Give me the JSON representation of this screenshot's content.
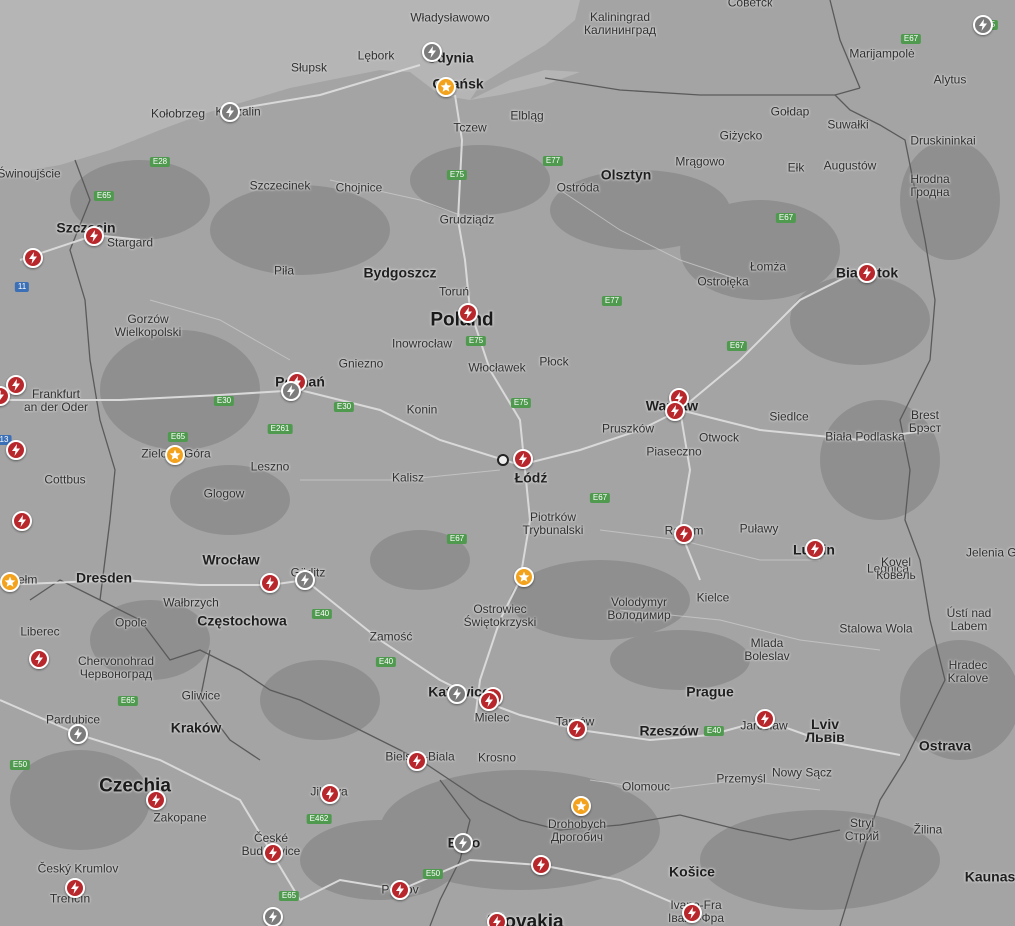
{
  "map": {
    "countries": [
      "Poland",
      "Czechia",
      "Slovakia"
    ],
    "cities": [
      {
        "name": "Władysławowo",
        "cls": "town"
      },
      {
        "name": "Gdynia",
        "cls": "big"
      },
      {
        "name": "Gdańsk",
        "cls": "big"
      },
      {
        "name": "Kaliningrad\nКалининград",
        "cls": "town"
      },
      {
        "name": "Советск",
        "cls": "town"
      },
      {
        "name": "Lębork",
        "cls": "town"
      },
      {
        "name": "Słupsk",
        "cls": "town"
      },
      {
        "name": "Kołobrzeg",
        "cls": "town"
      },
      {
        "name": "Koszalin",
        "cls": "town"
      },
      {
        "name": "Tczew",
        "cls": "town"
      },
      {
        "name": "Elbląg",
        "cls": "town"
      },
      {
        "name": "Marijampolė",
        "cls": "town"
      },
      {
        "name": "Alytus",
        "cls": "town"
      },
      {
        "name": "Gołdap",
        "cls": "town"
      },
      {
        "name": "Suwałki",
        "cls": "town"
      },
      {
        "name": "Giżycko",
        "cls": "town"
      },
      {
        "name": "Druskininkai",
        "cls": "town"
      },
      {
        "name": "Świnoujście",
        "cls": "town"
      },
      {
        "name": "Szczecinek",
        "cls": "town"
      },
      {
        "name": "Chojnice",
        "cls": "town"
      },
      {
        "name": "Ostróda",
        "cls": "town"
      },
      {
        "name": "Olsztyn",
        "cls": "big"
      },
      {
        "name": "Mrągowo",
        "cls": "town"
      },
      {
        "name": "Ełk",
        "cls": "town"
      },
      {
        "name": "Augustów",
        "cls": "town"
      },
      {
        "name": "Hrodna\nГродна",
        "cls": "town"
      },
      {
        "name": "Szczecin",
        "cls": "big"
      },
      {
        "name": "Stargard",
        "cls": "town"
      },
      {
        "name": "Grudziądz",
        "cls": "town"
      },
      {
        "name": "Piła",
        "cls": "town"
      },
      {
        "name": "Bydgoszcz",
        "cls": "big"
      },
      {
        "name": "Toruń",
        "cls": "town"
      },
      {
        "name": "Łomża",
        "cls": "town"
      },
      {
        "name": "Ostrołęka",
        "cls": "town"
      },
      {
        "name": "Białystok",
        "cls": "big"
      },
      {
        "name": "Gorzów\nWielkopolski",
        "cls": "town"
      },
      {
        "name": "Inowrocław",
        "cls": "town"
      },
      {
        "name": "Gniezno",
        "cls": "town"
      },
      {
        "name": "Włocławek",
        "cls": "town"
      },
      {
        "name": "Płock",
        "cls": "town"
      },
      {
        "name": "Poznań",
        "cls": "big"
      },
      {
        "name": "Frankfurt\nan der Oder",
        "cls": "town"
      },
      {
        "name": "Konin",
        "cls": "town"
      },
      {
        "name": "Warsaw",
        "cls": "big"
      },
      {
        "name": "Siedlce",
        "cls": "town"
      },
      {
        "name": "Brest\nБрэст",
        "cls": "town"
      },
      {
        "name": "Biała Podlaska",
        "cls": "town"
      },
      {
        "name": "Pruszków",
        "cls": "town"
      },
      {
        "name": "Otwock",
        "cls": "town"
      },
      {
        "name": "Piaseczno",
        "cls": "town"
      },
      {
        "name": "Zielona Góra",
        "cls": "town"
      },
      {
        "name": "Leszno",
        "cls": "town"
      },
      {
        "name": "Kalisz",
        "cls": "town"
      },
      {
        "name": "Łódź",
        "cls": "big"
      },
      {
        "name": "Cottbus",
        "cls": "town"
      },
      {
        "name": "Glogow",
        "cls": "town"
      },
      {
        "name": "Piotrków\nTrybunalski",
        "cls": "town"
      },
      {
        "name": "Radom",
        "cls": "town"
      },
      {
        "name": "Puławy",
        "cls": "town"
      },
      {
        "name": "Lublin",
        "cls": "big"
      },
      {
        "name": "Legnica",
        "cls": "town"
      },
      {
        "name": "Wrocław",
        "cls": "big"
      },
      {
        "name": "Görlitz",
        "cls": "town"
      },
      {
        "name": "Dresden",
        "cls": "big"
      },
      {
        "name": "Chełm",
        "cls": "town"
      },
      {
        "name": "Kovel\nКовель",
        "cls": "town"
      },
      {
        "name": "Jelenia Góra",
        "cls": "town"
      },
      {
        "name": "Wałbrzych",
        "cls": "town"
      },
      {
        "name": "Częstochowa",
        "cls": "big"
      },
      {
        "name": "Ostrowiec\nŚwiętokrzyski",
        "cls": "town"
      },
      {
        "name": "Kielce",
        "cls": "town"
      },
      {
        "name": "Volodymyr\nВолодимир",
        "cls": "town"
      },
      {
        "name": "Ústí nad\nLabem",
        "cls": "town"
      },
      {
        "name": "Liberec",
        "cls": "town"
      },
      {
        "name": "Opole",
        "cls": "town"
      },
      {
        "name": "Zamość",
        "cls": "town"
      },
      {
        "name": "Stalowa Wola",
        "cls": "town"
      },
      {
        "name": "Mlada\nBoleslav",
        "cls": "town"
      },
      {
        "name": "Chervonohrad\nЧервоноград",
        "cls": "town"
      },
      {
        "name": "Hradec\nKralove",
        "cls": "town"
      },
      {
        "name": "Gliwice",
        "cls": "town"
      },
      {
        "name": "Katowice",
        "cls": "big"
      },
      {
        "name": "Mielec",
        "cls": "town"
      },
      {
        "name": "Prague",
        "cls": "big"
      },
      {
        "name": "Pardubice",
        "cls": "town"
      },
      {
        "name": "Kraków",
        "cls": "big"
      },
      {
        "name": "Tarnów",
        "cls": "town"
      },
      {
        "name": "Rzeszów",
        "cls": "big"
      },
      {
        "name": "Jarosław",
        "cls": "town"
      },
      {
        "name": "Lviv\nЛьвів",
        "cls": "big"
      },
      {
        "name": "Ostrava",
        "cls": "big"
      },
      {
        "name": "Bielsko-Biala",
        "cls": "town"
      },
      {
        "name": "Krosno",
        "cls": "town"
      },
      {
        "name": "Przemyśl",
        "cls": "town"
      },
      {
        "name": "Nowy Sącz",
        "cls": "town"
      },
      {
        "name": "Olomouc",
        "cls": "town"
      },
      {
        "name": "Jihlava",
        "cls": "town"
      },
      {
        "name": "Zakopane",
        "cls": "town"
      },
      {
        "name": "Drohobych\nДрогобич",
        "cls": "town"
      },
      {
        "name": "Stryi\nСтрий",
        "cls": "town"
      },
      {
        "name": "Žilina",
        "cls": "town"
      },
      {
        "name": "Brno",
        "cls": "big"
      },
      {
        "name": "České\nBudějovice",
        "cls": "town"
      },
      {
        "name": "Český Krumlov",
        "cls": "town"
      },
      {
        "name": "Trenčín",
        "cls": "town"
      },
      {
        "name": "Prešov",
        "cls": "town"
      },
      {
        "name": "Košice",
        "cls": "big"
      },
      {
        "name": "Ivano-Fra\nІвано-Фра",
        "cls": "town"
      },
      {
        "name": "Kaunas",
        "cls": "big"
      }
    ],
    "road_shields": [
      {
        "label": "E85",
        "color": "green"
      },
      {
        "label": "E67",
        "color": "green"
      },
      {
        "label": "E28",
        "color": "green"
      },
      {
        "label": "E65",
        "color": "green"
      },
      {
        "label": "E75",
        "color": "green"
      },
      {
        "label": "E77",
        "color": "green"
      },
      {
        "label": "E67",
        "color": "green"
      },
      {
        "label": "E77",
        "color": "green"
      },
      {
        "label": "E75",
        "color": "green"
      },
      {
        "label": "E67",
        "color": "green"
      },
      {
        "label": "11",
        "color": "blue"
      },
      {
        "label": "E30",
        "color": "green"
      },
      {
        "label": "E30",
        "color": "green"
      },
      {
        "label": "E261",
        "color": "green"
      },
      {
        "label": "E75",
        "color": "green"
      },
      {
        "label": "E65",
        "color": "green"
      },
      {
        "label": "13",
        "color": "blue"
      },
      {
        "label": "E67",
        "color": "green"
      },
      {
        "label": "E67",
        "color": "green"
      },
      {
        "label": "E40",
        "color": "green"
      },
      {
        "label": "E40",
        "color": "green"
      },
      {
        "label": "E65",
        "color": "green"
      },
      {
        "label": "E40",
        "color": "green"
      },
      {
        "label": "E50",
        "color": "green"
      },
      {
        "label": "E462",
        "color": "green"
      },
      {
        "label": "E50",
        "color": "green"
      },
      {
        "label": "E65",
        "color": "green"
      }
    ],
    "markers": [
      {
        "kind": "grey",
        "icon": "lightning-icon"
      },
      {
        "kind": "star",
        "icon": "star-icon"
      },
      {
        "kind": "grey",
        "icon": "lightning-icon"
      },
      {
        "kind": "red",
        "icon": "lightning-icon"
      },
      {
        "kind": "red",
        "icon": "lightning-icon"
      },
      {
        "kind": "red",
        "icon": "lightning-icon"
      },
      {
        "kind": "red",
        "icon": "lightning-icon"
      },
      {
        "kind": "red",
        "icon": "lightning-icon"
      },
      {
        "kind": "grey",
        "icon": "lightning-icon"
      },
      {
        "kind": "red",
        "icon": "lightning-icon"
      },
      {
        "kind": "red",
        "icon": "lightning-icon"
      },
      {
        "kind": "red",
        "icon": "lightning-icon"
      },
      {
        "kind": "red",
        "icon": "lightning-icon"
      },
      {
        "kind": "red",
        "icon": "lightning-icon"
      },
      {
        "kind": "star",
        "icon": "star-icon"
      },
      {
        "kind": "red",
        "icon": "lightning-icon"
      },
      {
        "kind": "red",
        "icon": "lightning-icon"
      },
      {
        "kind": "red",
        "icon": "lightning-icon"
      },
      {
        "kind": "red",
        "icon": "lightning-icon"
      },
      {
        "kind": "star",
        "icon": "star-icon"
      },
      {
        "kind": "red",
        "icon": "lightning-icon"
      },
      {
        "kind": "grey",
        "icon": "lightning-icon"
      },
      {
        "kind": "star",
        "icon": "star-icon"
      },
      {
        "kind": "red",
        "icon": "lightning-icon"
      },
      {
        "kind": "grey",
        "icon": "lightning-icon"
      },
      {
        "kind": "red",
        "icon": "lightning-icon"
      },
      {
        "kind": "red",
        "icon": "lightning-icon"
      },
      {
        "kind": "red",
        "icon": "lightning-icon"
      },
      {
        "kind": "red",
        "icon": "lightning-icon"
      },
      {
        "kind": "grey",
        "icon": "lightning-icon"
      },
      {
        "kind": "red",
        "icon": "lightning-icon"
      },
      {
        "kind": "red",
        "icon": "lightning-icon"
      },
      {
        "kind": "star",
        "icon": "star-icon"
      },
      {
        "kind": "red",
        "icon": "lightning-icon"
      },
      {
        "kind": "grey",
        "icon": "lightning-icon"
      },
      {
        "kind": "red",
        "icon": "lightning-icon"
      },
      {
        "kind": "red",
        "icon": "lightning-icon"
      },
      {
        "kind": "red",
        "icon": "lightning-icon"
      },
      {
        "kind": "red",
        "icon": "lightning-icon"
      },
      {
        "kind": "red",
        "icon": "lightning-icon"
      },
      {
        "kind": "red",
        "icon": "lightning-icon"
      },
      {
        "kind": "grey",
        "icon": "lightning-icon"
      },
      {
        "kind": "grey",
        "icon": "lightning-icon"
      }
    ],
    "colors": {
      "land": "#a4a4a4",
      "forest": "#8a8a8a",
      "sea": "#b5b5b5",
      "charger_red": "#b8272b",
      "charger_grey": "#7c7c7c",
      "destination_star": "#f2a21d",
      "road": "#d9d9d9",
      "border": "#5a5a5a"
    }
  }
}
